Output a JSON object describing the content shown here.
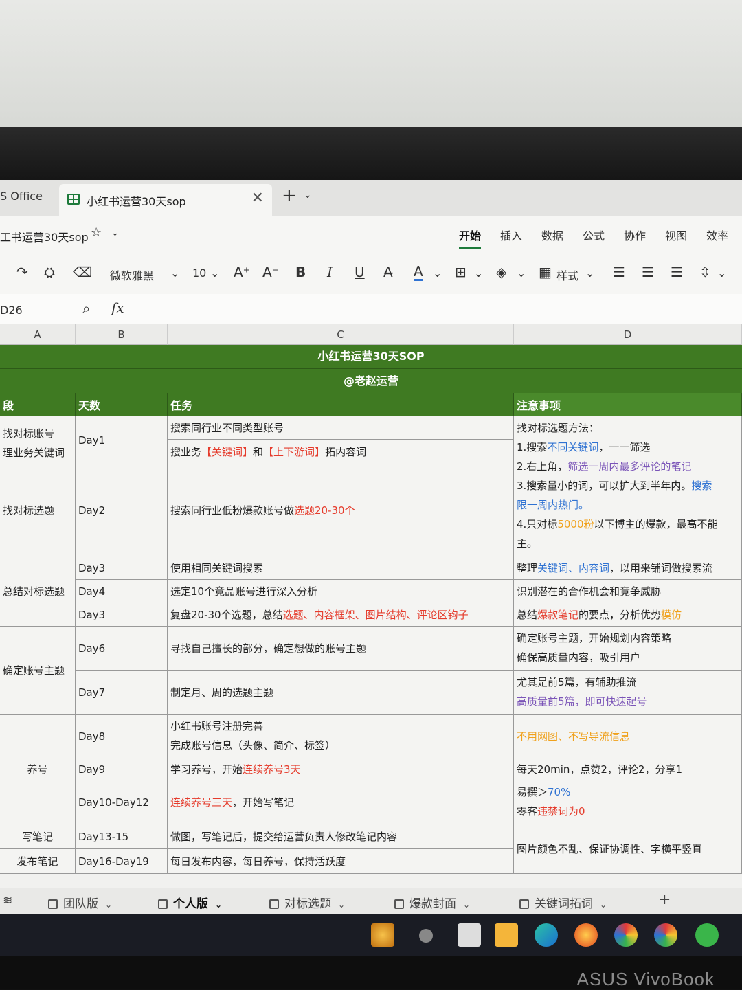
{
  "window": {
    "app_tab": "S Office",
    "doc_tab": "小红书运营30天sop",
    "close": "✕",
    "new_tab": "+",
    "new_tab_menu": "⌄"
  },
  "docbar": {
    "name": "工书运营30天sop",
    "star": "☆",
    "menu_arrow": "⌄",
    "menus": [
      "开始",
      "插入",
      "数据",
      "公式",
      "协作",
      "视图",
      "效率"
    ]
  },
  "toolbar": {
    "font": "微软雅黑",
    "size": "10",
    "grow": "A⁺",
    "shrink": "A⁻",
    "bold": "B",
    "italic": "I",
    "underline": "U",
    "strike": "A̶",
    "fontcolor": "A",
    "styles": "样式",
    "dropdown": "⌄"
  },
  "formula": {
    "cellref": "D26",
    "fx": "fx"
  },
  "columns": [
    "A",
    "B",
    "C",
    "D"
  ],
  "sheet": {
    "title": "小红书运营30天SOP",
    "author": "@老赵运营",
    "headers": {
      "stage": "段",
      "day": "天数",
      "task": "任务",
      "notes": "注意事项"
    },
    "rows": {
      "r1": {
        "stage": [
          "找对标账号",
          "理业务关键词"
        ],
        "day": "Day1",
        "tasks": [
          "搜索同行业不同类型账号",
          "搜业务",
          "【关键词】",
          "和",
          "【上下游词】",
          "拓内容词"
        ]
      },
      "r2": {
        "stage": "找对标选题",
        "day": "Day2",
        "task_a": "搜索同行业低粉爆款账号做",
        "task_b": "选题20-30个"
      },
      "notes_method": {
        "title": "找对标选题方法：",
        "l1a": "1.搜索",
        "l1b": "不同关键词",
        "l1c": "，一一筛选",
        "l2a": "2.右上角，",
        "l2b": "筛选一周内最多评论的笔记",
        "l3a": "3.搜索量小的词，可以扩大到半年内。",
        "l3b": "搜索",
        "l3c": "限一周内热门。",
        "l4a": "4.只对标",
        "l4b": "5000粉",
        "l4c": "以下博主的爆款，最高不能",
        "l4d": "主。"
      },
      "r3": {
        "stage": "总结对标选题",
        "days": [
          "Day3",
          "Day4",
          "Day3"
        ],
        "tasks": [
          "使用相同关键词搜索",
          "选定10个竞品账号进行深入分析",
          "复盘20-30个选题，总结",
          "选题、内容框架、图片结构、评论区钩子"
        ],
        "notes": [
          "整理",
          "关键词、内容词",
          "，以用来铺词做搜索流",
          "识别潜在的合作机会和竞争威胁",
          "总结",
          "爆款笔记",
          "的要点，分析优势",
          "模仿"
        ]
      },
      "r4": {
        "stage": "确定账号主题",
        "days": [
          "Day6",
          "Day7"
        ],
        "tasks": [
          "寻找自己擅长的部分，确定想做的账号主题",
          "制定月、周的选题主题"
        ],
        "notes": [
          "确定账号主题，开始规划内容策略",
          "确保高质量内容，吸引用户",
          "尤其是前5篇，有辅助推流",
          "高质量前5篇，即可快速起号"
        ]
      },
      "r5": {
        "stage": "养号",
        "days": [
          "Day8",
          "Day9",
          "Day10-Day12"
        ],
        "tasks": [
          "小红书账号注册完善",
          "完成账号信息（头像、简介、标签）",
          "学习养号，开始",
          "连续养号3天",
          "连续养号三天",
          "，开始写笔记"
        ],
        "notes": [
          "不用网图、不写导流信息",
          "每天20min，点赞2，评论2，分享1",
          "易撰＞",
          "70%",
          "零客",
          "违禁词为0"
        ]
      },
      "r6": {
        "stages": [
          "写笔记",
          "发布笔记"
        ],
        "days": [
          "Day13-15",
          "Day16-Day19"
        ],
        "tasks": [
          "做图，写笔记后，提交给运营负责人修改笔记内容",
          "每日发布内容，每日养号，保持活跃度"
        ],
        "note": "图片颜色不乱、保证协调性、字横平竖直"
      }
    }
  },
  "sheet_tabs": [
    "团队版",
    "个人版",
    "对标选题",
    "爆款封面",
    "关键词拓词"
  ],
  "sheet_add": "+",
  "brand": "ASUS VivoBook",
  "colors": {
    "header_green": "#3f7a22",
    "red": "#e53b2c",
    "blue": "#2f72d2",
    "purple": "#7b55b8",
    "orange": "#f0a11c"
  }
}
